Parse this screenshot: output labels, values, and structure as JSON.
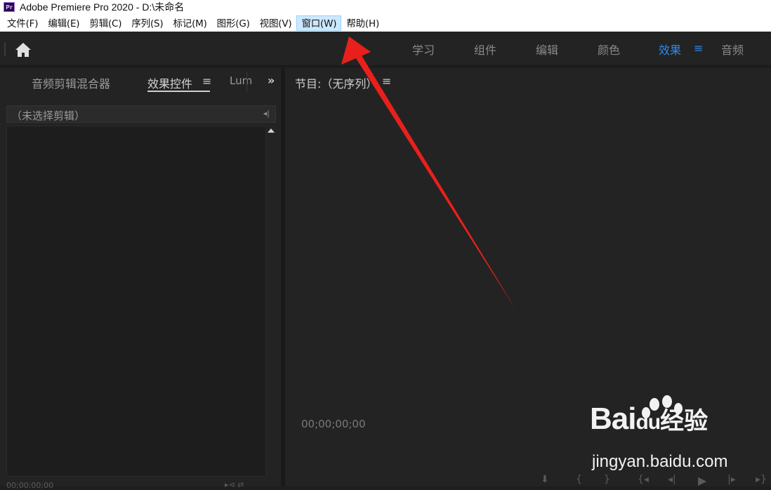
{
  "window": {
    "app_icon_label": "Pr",
    "title": "Adobe Premiere Pro 2020 - D:\\未命名"
  },
  "menubar": {
    "items": [
      {
        "label": "文件(F)"
      },
      {
        "label": "编辑(E)"
      },
      {
        "label": "剪辑(C)"
      },
      {
        "label": "序列(S)"
      },
      {
        "label": "标记(M)"
      },
      {
        "label": "图形(G)"
      },
      {
        "label": "视图(V)"
      },
      {
        "label": "窗口(W)",
        "active": true
      },
      {
        "label": "帮助(H)"
      }
    ]
  },
  "workspaces": {
    "tabs": [
      "学习",
      "组件",
      "编辑",
      "颜色",
      "效果",
      "音频"
    ],
    "active": "效果",
    "menu_glyph": "≡",
    "accent_color": "#2d8ceb"
  },
  "left_panel": {
    "tabs": [
      {
        "label": "音频剪辑混合器"
      },
      {
        "label": "效果控件",
        "active": true
      },
      {
        "label": "Lum"
      }
    ],
    "menu_glyph": "≡",
    "overflow_glyph": "»",
    "clip_label": "（未选择剪辑）",
    "timecode": "00;00;00;00"
  },
  "program_monitor": {
    "title": "节目:（无序列）",
    "menu_glyph": "≡",
    "timecode": "00;00;00;00"
  },
  "watermark": {
    "brand": "Bai",
    "brand2": "du",
    "cn": "经验",
    "url": "jingyan.baidu.com"
  }
}
